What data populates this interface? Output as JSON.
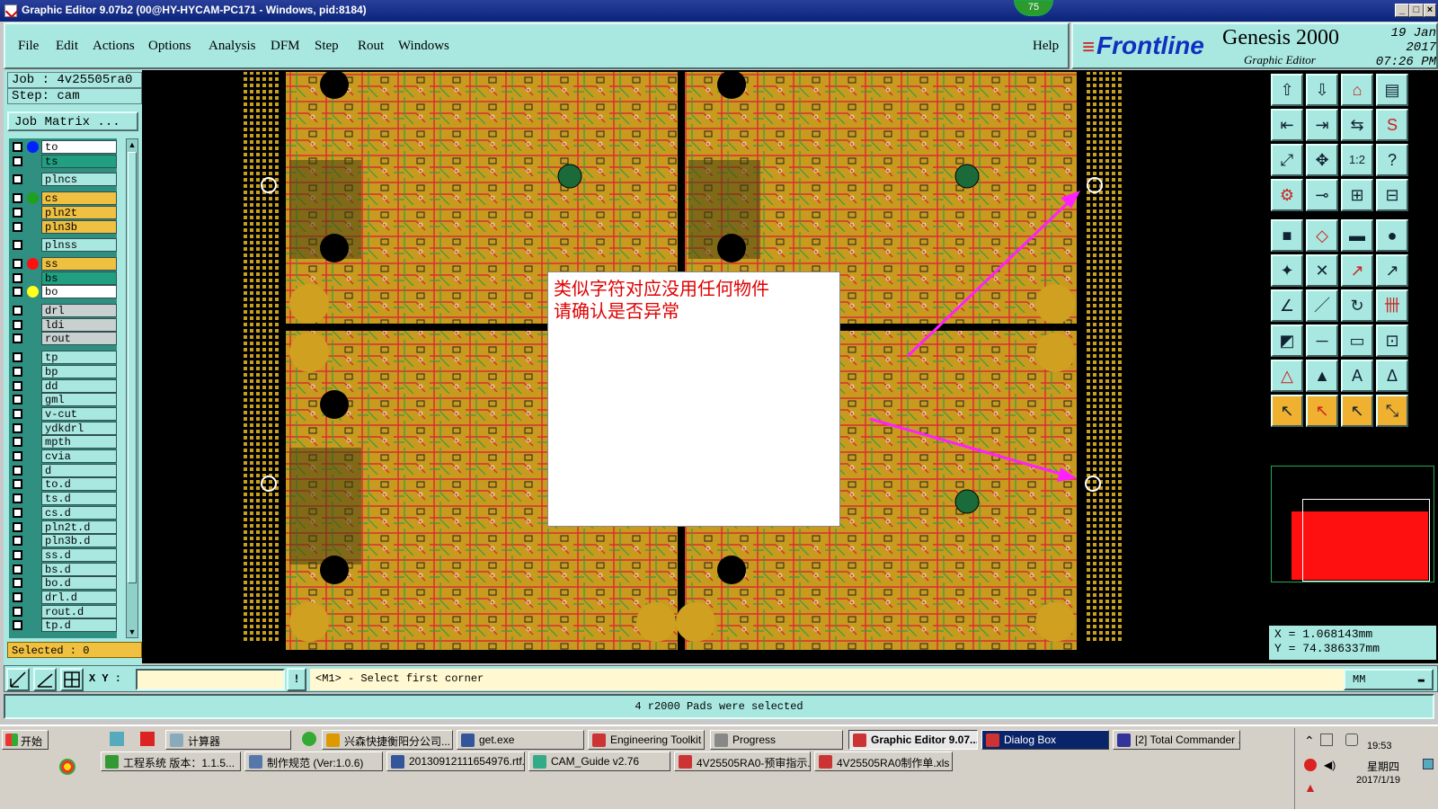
{
  "titlebar": {
    "title": "Graphic Editor 9.07b2 (00@HY-HYCAM-PC171 - Windows, pid:8184)",
    "badge": "75"
  },
  "menu": {
    "items": [
      "File",
      "Edit",
      "Actions",
      "Options",
      "Analysis",
      "DFM",
      "Step",
      "Rout",
      "Windows"
    ],
    "help": "Help"
  },
  "brand": {
    "logo": "Frontline",
    "title": "Genesis 2000",
    "subtitle": "Graphic Editor",
    "date": "19 Jan 2017",
    "time": "07:26 PM"
  },
  "job": {
    "job_line": "Job : 4v25505ra0",
    "step_line": "Step: cam",
    "matrix_button": "Job Matrix ..."
  },
  "layers": [
    {
      "name": "to",
      "color": "#ffffff",
      "dot": "#0020ff"
    },
    {
      "name": "ts",
      "color": "#20a080",
      "dot": ""
    },
    {
      "name": "plncs",
      "color": "#a8e8e0",
      "dot": ""
    },
    {
      "name": "cs",
      "color": "#f0c040",
      "dot": "#20a020"
    },
    {
      "name": "pln2t",
      "color": "#f0c040",
      "dot": ""
    },
    {
      "name": "pln3b",
      "color": "#f0c040",
      "dot": ""
    },
    {
      "name": "plnss",
      "color": "#a8e8e0",
      "dot": ""
    },
    {
      "name": "ss",
      "color": "#f0c040",
      "dot": "#ff1010"
    },
    {
      "name": "bs",
      "color": "#20a080",
      "dot": ""
    },
    {
      "name": "bo",
      "color": "#ffffff",
      "dot": "#ffff20"
    },
    {
      "name": "drl",
      "color": "#c8d0d0",
      "dot": ""
    },
    {
      "name": "ldi",
      "color": "#c8d0d0",
      "dot": ""
    },
    {
      "name": "rout",
      "color": "#c8d0d0",
      "dot": ""
    },
    {
      "name": "tp",
      "color": "#a8e8e0",
      "dot": ""
    },
    {
      "name": "bp",
      "color": "#a8e8e0",
      "dot": ""
    },
    {
      "name": "dd",
      "color": "#a8e8e0",
      "dot": ""
    },
    {
      "name": "gml",
      "color": "#a8e8e0",
      "dot": ""
    },
    {
      "name": "v-cut",
      "color": "#a8e8e0",
      "dot": ""
    },
    {
      "name": "ydkdrl",
      "color": "#a8e8e0",
      "dot": ""
    },
    {
      "name": "mpth",
      "color": "#a8e8e0",
      "dot": ""
    },
    {
      "name": "cvia",
      "color": "#a8e8e0",
      "dot": ""
    },
    {
      "name": "d",
      "color": "#a8e8e0",
      "dot": ""
    },
    {
      "name": "to.d",
      "color": "#a8e8e0",
      "dot": ""
    },
    {
      "name": "ts.d",
      "color": "#a8e8e0",
      "dot": ""
    },
    {
      "name": "cs.d",
      "color": "#a8e8e0",
      "dot": ""
    },
    {
      "name": "pln2t.d",
      "color": "#a8e8e0",
      "dot": ""
    },
    {
      "name": "pln3b.d",
      "color": "#a8e8e0",
      "dot": ""
    },
    {
      "name": "ss.d",
      "color": "#a8e8e0",
      "dot": ""
    },
    {
      "name": "bs.d",
      "color": "#a8e8e0",
      "dot": ""
    },
    {
      "name": "bo.d",
      "color": "#a8e8e0",
      "dot": ""
    },
    {
      "name": "drl.d",
      "color": "#a8e8e0",
      "dot": ""
    },
    {
      "name": "rout.d",
      "color": "#a8e8e0",
      "dot": ""
    },
    {
      "name": "tp.d",
      "color": "#a8e8e0",
      "dot": ""
    }
  ],
  "selected": "Selected : 0",
  "annotation": {
    "line1": "类似字符对应没用任何物件",
    "line2": "请确认是否异常"
  },
  "coords": {
    "x": "X = 1.068143mm",
    "y": "Y = 74.386337mm"
  },
  "cmd": {
    "xy_label": "X Y :",
    "xy_value": "",
    "prompt": "<M1> - Select first corner",
    "units": "MM"
  },
  "status": "4 r2000 Pads were selected",
  "taskbar": {
    "start": "开始",
    "row1": [
      "计算器",
      "兴森快捷衡阳分公司...",
      "get.exe",
      "Engineering Toolkit 9....",
      "Progress",
      "Graphic Editor 9.07...",
      "Dialog Box",
      "[2] Total Commander ..."
    ],
    "row2": [
      "工程系统  版本：1.1.5...",
      "制作规范 (Ver:1.0.6)",
      "20130912111654976.rtf...",
      "CAM_Guide v2.76",
      "4V25505RA0-预审指示....",
      "4V25505RA0制作单.xls ..."
    ],
    "clock": "19:53",
    "weekday": "星期四",
    "date": "2017/1/19"
  }
}
